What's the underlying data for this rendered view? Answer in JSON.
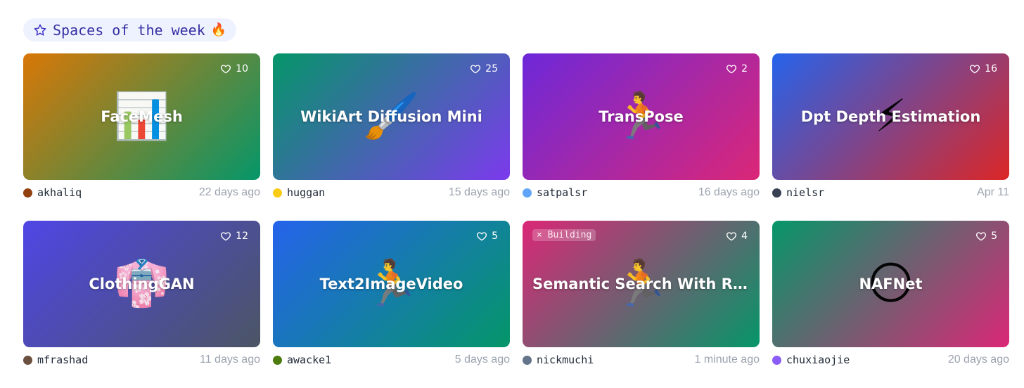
{
  "section": {
    "title": "Spaces of the week",
    "star_icon": "star-icon",
    "fire_icon": "🔥"
  },
  "spaces": [
    {
      "title": "FaceMesh",
      "emoji": "📊",
      "likes": "10",
      "author": "akhaliq",
      "time": "22 days ago",
      "badge": "",
      "gradient": [
        "#d97706",
        "#059669"
      ],
      "avatar": "#92400e"
    },
    {
      "title": "WikiArt Diffusion Mini",
      "emoji": "🖌️",
      "likes": "25",
      "author": "huggan",
      "time": "15 days ago",
      "badge": "",
      "gradient": [
        "#059669",
        "#7c3aed"
      ],
      "avatar": "#facc15"
    },
    {
      "title": "TransPose",
      "emoji": "🏃",
      "likes": "2",
      "author": "satpalsr",
      "time": "16 days ago",
      "badge": "",
      "gradient": [
        "#6d28d9",
        "#db2777"
      ],
      "avatar": "#60a5fa"
    },
    {
      "title": "Dpt Depth Estimation",
      "emoji": "⚡",
      "likes": "16",
      "author": "nielsr",
      "time": "Apr 11",
      "badge": "",
      "gradient": [
        "#2563eb",
        "#dc2626"
      ],
      "avatar": "#374151"
    },
    {
      "title": "ClothingGAN",
      "emoji": "👘",
      "likes": "12",
      "author": "mfrashad",
      "time": "11 days ago",
      "badge": "",
      "gradient": [
        "#4f46e5",
        "#4b5563"
      ],
      "avatar": "#6b4f3f"
    },
    {
      "title": "Text2ImageVideo",
      "emoji": "🏃",
      "likes": "5",
      "author": "awacke1",
      "time": "5 days ago",
      "badge": "",
      "gradient": [
        "#2563eb",
        "#059669"
      ],
      "avatar": "#4d7c0f"
    },
    {
      "title": "Semantic Search With Retrieve ...",
      "emoji": "🏃",
      "likes": "4",
      "author": "nickmuchi",
      "time": "1 minute ago",
      "badge": "× Building",
      "gradient": [
        "#db2777",
        "#059669"
      ],
      "avatar": "#64748b"
    },
    {
      "title": "NAFNet",
      "emoji": "🌕",
      "likes": "5",
      "author": "chuxiaojie",
      "time": "20 days ago",
      "badge": "",
      "gradient": [
        "#059669",
        "#db2777"
      ],
      "avatar": "#8b5cf6"
    }
  ]
}
